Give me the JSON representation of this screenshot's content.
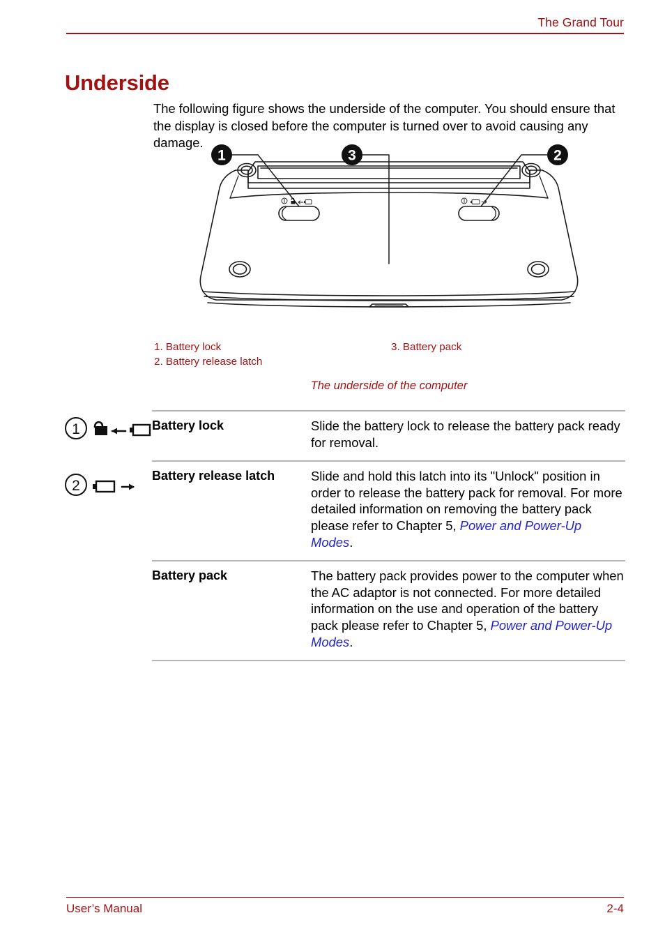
{
  "header": {
    "chapter_title": "The Grand Tour",
    "rule_color": "#A11212"
  },
  "heading": {
    "title": "Underside",
    "color": "#A11212"
  },
  "intro": {
    "paragraph": "The following figure shows the underside of the computer. You should ensure that the display is closed before the computer is turned over to avoid causing any damage."
  },
  "figure": {
    "callouts": [
      {
        "number": "1",
        "target": "battery-lock-slider"
      },
      {
        "number": "3",
        "target": "battery-pack"
      },
      {
        "number": "2",
        "target": "battery-release-latch-slider"
      }
    ],
    "legend": [
      {
        "number": "1.",
        "label": "Battery lock"
      },
      {
        "number": "2.",
        "label": "Battery release latch"
      },
      {
        "number": "3.",
        "label": "Battery pack"
      }
    ],
    "legend_text": {
      "item1": "1. Battery lock",
      "item2": "2. Battery release latch",
      "item3": "3. Battery pack"
    },
    "caption": "The underside of the computer",
    "caption_color": "#A11212"
  },
  "definitions": {
    "rows": [
      {
        "marker": "1",
        "icon": "unlock-battery-icon",
        "term": "Battery lock",
        "description_plain": "Slide the battery lock to release the battery pack ready for removal.",
        "description_parts": [
          {
            "text": "Slide the battery lock to release the battery pack ready for removal.",
            "style": "normal"
          }
        ]
      },
      {
        "marker": "2",
        "icon": "battery-eject-icon",
        "term": "Battery release latch",
        "description_plain": "Slide and hold this latch into its \"Unlock\" position in order to release the battery pack for removal. For more detailed information on removing the battery pack please refer to Chapter 5, Power and Power-Up Modes.",
        "description_parts": [
          {
            "text": "Slide and hold this latch into its \"Unlock\" position in order to release the battery pack for removal. For more detailed information on removing the battery pack please refer to Chapter 5, ",
            "style": "normal"
          },
          {
            "text": "Power and Power-Up Modes",
            "style": "xref"
          },
          {
            "text": ".",
            "style": "normal"
          }
        ]
      },
      {
        "marker": "",
        "icon": "",
        "term": "Battery pack",
        "description_plain": "The battery pack provides power to the computer when the AC adaptor is not connected. For more detailed information on the use and operation of the battery pack please refer to Chapter 5, Power and Power-Up Modes.",
        "description_parts": [
          {
            "text": "The battery pack provides power to the computer when the AC adaptor is not connected. For more detailed information on the use and operation of the battery pack please refer to Chapter 5, ",
            "style": "normal"
          },
          {
            "text": "Power and Power-Up Modes",
            "style": "xref"
          },
          {
            "text": ".",
            "style": "normal"
          }
        ]
      }
    ],
    "xref_color": "#2323C8",
    "rule_color": "#b5b5b5"
  },
  "footer": {
    "manual_label": "User’s Manual",
    "page_number": "2-4",
    "color": "#A11212"
  }
}
